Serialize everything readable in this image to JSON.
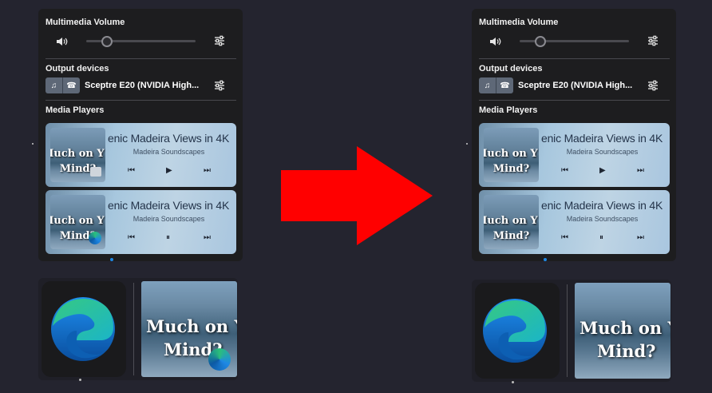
{
  "panels": [
    {
      "volume": {
        "title": "Multimedia Volume",
        "level_fraction": 0.19
      },
      "output": {
        "title": "Output devices",
        "device_name": "Sceptre E20 (NVIDIA High..."
      },
      "media": {
        "title": "Media Players"
      },
      "players": [
        {
          "title": "enic Madeira Views in 4K",
          "artist": "Madeira Soundscapes",
          "thumb_line1": "Much on Y",
          "thumb_line2": "Mind?",
          "playback_state": "paused"
        },
        {
          "title": "enic Madeira Views in 4K",
          "artist": "Madeira Soundscapes",
          "thumb_line1": "Much on Y",
          "thumb_line2": "Mind?",
          "playback_state": "playing"
        }
      ],
      "taskbar": {
        "thumb_line1": "Much on Y",
        "thumb_line2": "Mind?"
      }
    },
    {
      "volume": {
        "title": "Multimedia Volume",
        "level_fraction": 0.19
      },
      "output": {
        "title": "Output devices",
        "device_name": "Sceptre E20 (NVIDIA High..."
      },
      "media": {
        "title": "Media Players"
      },
      "players": [
        {
          "title": "enic Madeira Views in 4K",
          "artist": "Madeira Soundscapes",
          "thumb_line1": "Much on Y",
          "thumb_line2": "Mind?",
          "playback_state": "paused"
        },
        {
          "title": "enic Madeira Views in 4K",
          "artist": "Madeira Soundscapes",
          "thumb_line1": "Much on Y",
          "thumb_line2": "Mind?",
          "playback_state": "playing"
        }
      ],
      "taskbar": {
        "thumb_line1": "Much on Y",
        "thumb_line2": "Mind?"
      }
    }
  ],
  "icons": {
    "volume": "speaker-icon",
    "equalizer": "sliders-icon",
    "music_note": "♫",
    "phone": "☎",
    "prev": "⏮",
    "play": "▶",
    "pause": "⏸",
    "next": "⏭",
    "arrow": "arrow-right-icon",
    "browser": "edge-browser-icon"
  },
  "colors": {
    "arrow": "#ff0000",
    "accent": "#1e88e5",
    "background": "#24242f"
  }
}
